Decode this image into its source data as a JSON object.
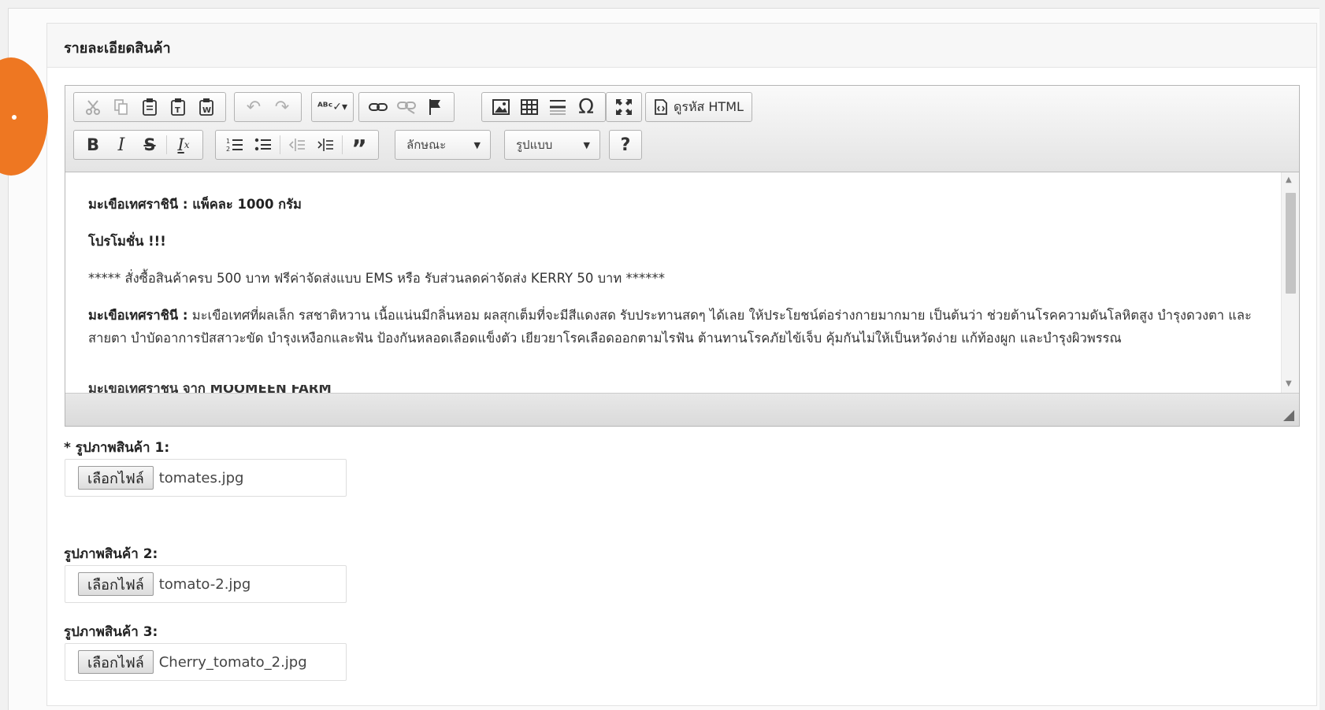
{
  "panel": {
    "title": "รายละเอียดสินค้า"
  },
  "colors": {
    "accent_badge": "#ee7722",
    "toolbar_bg": "#e4e4e4"
  },
  "editor": {
    "toolbar_row1": {
      "clipboard": [
        "cut-icon",
        "copy-icon",
        "paste-icon",
        "paste-text-icon",
        "paste-word-icon"
      ],
      "history": [
        "undo-icon",
        "redo-icon"
      ],
      "spellcheck": "spellcheck-icon",
      "links": [
        "link-icon",
        "unlink-icon",
        "anchor-flag-icon"
      ],
      "insert": [
        "image-icon",
        "table-icon",
        "horizontal-rule-icon",
        "special-char-icon"
      ],
      "maximize": "maximize-icon",
      "source_label": "ดูรหัส HTML"
    },
    "toolbar_row2": {
      "basic": [
        "bold-icon",
        "italic-icon",
        "strike-icon",
        "remove-format-icon"
      ],
      "lists": [
        "numbered-list-icon",
        "bulleted-list-icon",
        "outdent-icon",
        "indent-icon",
        "blockquote-icon"
      ],
      "style_combo": "ลักษณะ",
      "format_combo": "รูปแบบ",
      "help_label": "?"
    },
    "content": {
      "line1": "มะเขือเทศราชินี : แพ็คละ 1000 กรัม",
      "line2": "โปรโมชั่น !!!",
      "line3": "***** สั่งซื้อสินค้าครบ 500 บาท ฟรีค่าจัดส่งแบบ EMS หรือ รับส่วนลดค่าจัดส่ง KERRY 50 บาท ******",
      "line4_bold": "มะเขือเทศราชินี :",
      "line4_text": " มะเขือเทศที่ผลเล็ก รสชาติหวาน เนื้อแน่นมีกลิ่นหอม ผลสุกเต็มที่จะมีสีแดงสด รับประทานสดๆ ได้เลย ให้ประโยชน์ต่อร่างกายมากมาย เป็นต้นว่า ช่วยต้านโรคความดันโลหิตสูง บำรุงดวงตา และสายตา บำบัดอาการปัสสาวะขัด บำรุงเหงือกและฟัน ป้องกันหลอดเลือดแข็งตัว เยียวยาโรคเลือดออกตามไรฟัน ต้านทานโรคภัยไข้เจ็บ คุ้มกันไม่ให้เป็นหวัดง่าย แก้ท้องผูก และบำรุงผิวพรรณ",
      "line5_partial": "มะเขือเทศราชินี จาก MOOMEEN FARM"
    }
  },
  "images": [
    {
      "label": "* รูปภาพสินค้า 1:",
      "button": "เลือกไฟล์",
      "filename": "tomates.jpg"
    },
    {
      "label": "รูปภาพสินค้า 2:",
      "button": "เลือกไฟล์",
      "filename": "tomato-2.jpg"
    },
    {
      "label": "รูปภาพสินค้า 3:",
      "button": "เลือกไฟล์",
      "filename": "Cherry_tomato_2.jpg"
    }
  ]
}
